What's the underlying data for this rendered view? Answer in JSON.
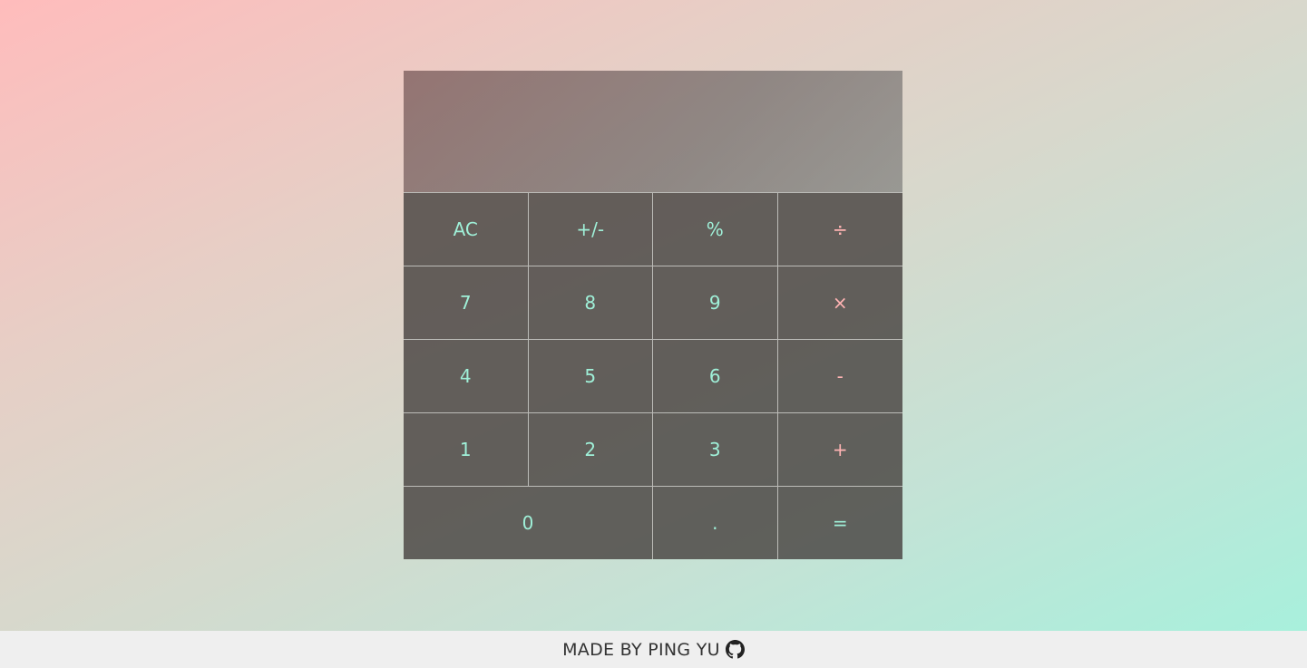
{
  "display": {
    "value": ""
  },
  "buttons": [
    {
      "id": "clear",
      "label": "AC",
      "kind": "func"
    },
    {
      "id": "negate",
      "label": "+/-",
      "kind": "func"
    },
    {
      "id": "percent",
      "label": "%",
      "kind": "func"
    },
    {
      "id": "divide",
      "label": "÷",
      "kind": "op"
    },
    {
      "id": "seven",
      "label": "7",
      "kind": "digit"
    },
    {
      "id": "eight",
      "label": "8",
      "kind": "digit"
    },
    {
      "id": "nine",
      "label": "9",
      "kind": "digit"
    },
    {
      "id": "multiply",
      "label": "×",
      "kind": "op"
    },
    {
      "id": "four",
      "label": "4",
      "kind": "digit"
    },
    {
      "id": "five",
      "label": "5",
      "kind": "digit"
    },
    {
      "id": "six",
      "label": "6",
      "kind": "digit"
    },
    {
      "id": "subtract",
      "label": "-",
      "kind": "op"
    },
    {
      "id": "one",
      "label": "1",
      "kind": "digit"
    },
    {
      "id": "two",
      "label": "2",
      "kind": "digit"
    },
    {
      "id": "three",
      "label": "3",
      "kind": "digit"
    },
    {
      "id": "add",
      "label": "+",
      "kind": "op"
    },
    {
      "id": "zero",
      "label": "0",
      "kind": "digit"
    },
    {
      "id": "decimal",
      "label": ".",
      "kind": "digit"
    },
    {
      "id": "equals",
      "label": "=",
      "kind": "eq"
    }
  ],
  "footer": {
    "text": "MADE BY PING YU",
    "icon": "github-icon"
  },
  "colors": {
    "digit_text": "#9ff0d8",
    "operator_text": "#ffb3b3",
    "button_bg": "#4b4644"
  }
}
